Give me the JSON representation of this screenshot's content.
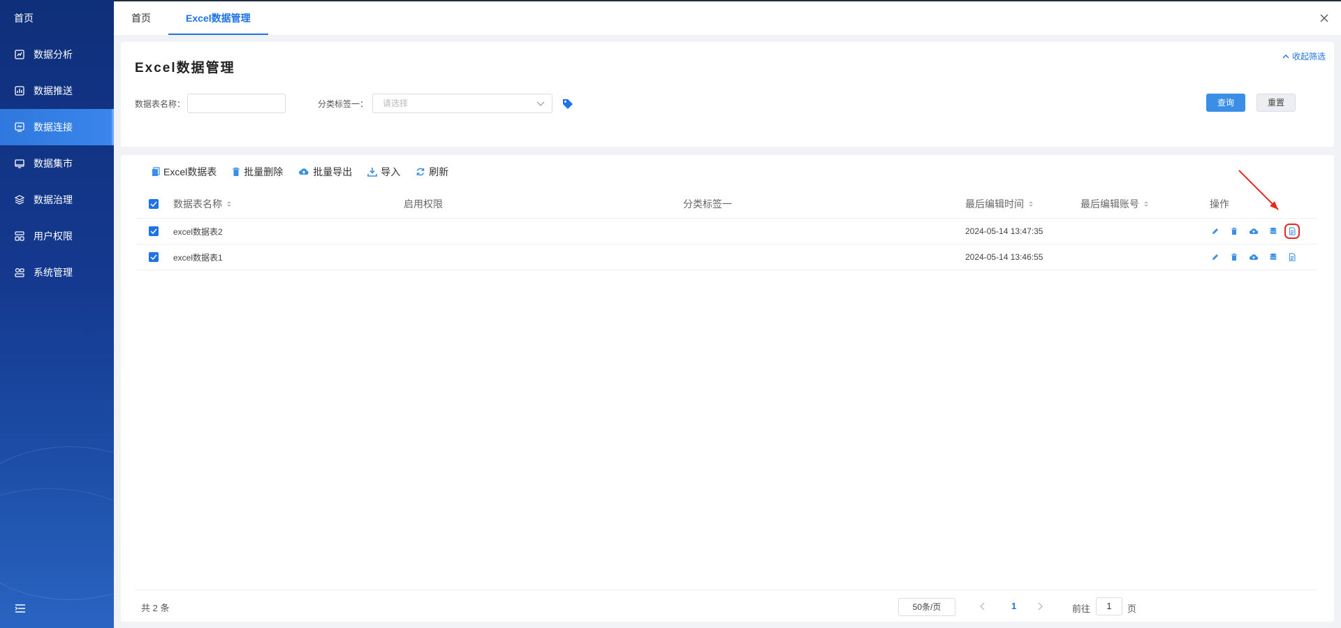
{
  "sidebar": {
    "home": "首页",
    "items": [
      {
        "label": "数据分析",
        "icon": "analysis-icon"
      },
      {
        "label": "数据推送",
        "icon": "chart-icon"
      },
      {
        "label": "数据连接",
        "icon": "connection-icon",
        "active": true
      },
      {
        "label": "数据集市",
        "icon": "monitor-icon"
      },
      {
        "label": "数据治理",
        "icon": "layers-icon"
      },
      {
        "label": "用户权限",
        "icon": "user-permission-icon"
      },
      {
        "label": "系统管理",
        "icon": "system-icon"
      }
    ]
  },
  "tabs": [
    {
      "label": "首页"
    },
    {
      "label": "Excel数据管理",
      "active": true
    }
  ],
  "filter": {
    "title": "Excel数据管理",
    "collapse": "收起筛选",
    "name_label": "数据表名称：",
    "name_value": "",
    "tag_label": "分类标签一：",
    "tag_placeholder": "请选择",
    "query": "查询",
    "reset": "重置"
  },
  "toolbar": {
    "excel_table": "Excel数据表",
    "batch_delete": "批量删除",
    "batch_export": "批量导出",
    "import": "导入",
    "refresh": "刷新"
  },
  "table": {
    "headers": {
      "name": "数据表名称",
      "permission": "启用权限",
      "tag": "分类标签一",
      "edit_time": "最后编辑时间",
      "edit_account": "最后编辑账号",
      "ops": "操作"
    },
    "rows": [
      {
        "name": "excel数据表2",
        "permission": "",
        "tag": "",
        "edit_time": "2024-05-14 13:47:35",
        "edit_account": ""
      },
      {
        "name": "excel数据表1",
        "permission": "",
        "tag": "",
        "edit_time": "2024-05-14 13:46:55",
        "edit_account": ""
      }
    ]
  },
  "footer": {
    "total": "共 2 条",
    "page_size": "50条/页",
    "current_page": "1",
    "goto_label": "前往",
    "goto_value": "1",
    "goto_suffix": "页"
  },
  "colors": {
    "primary": "#1e73e6",
    "sidebar": "#14398f",
    "highlight": "#e8281f"
  }
}
